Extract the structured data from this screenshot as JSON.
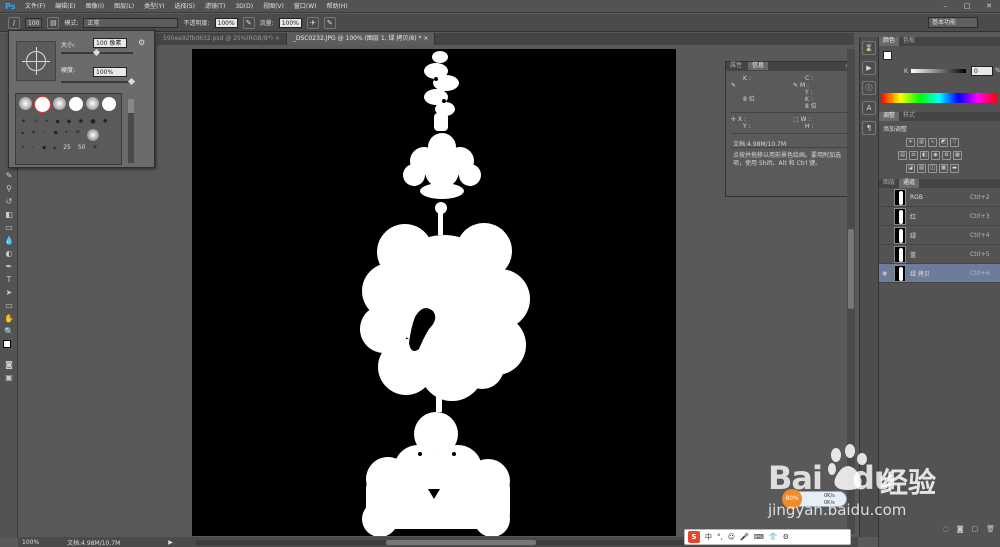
{
  "app": {
    "logo": "Ps",
    "menu": [
      "文件(F)",
      "编辑(E)",
      "图像(I)",
      "图层(L)",
      "类型(Y)",
      "选择(S)",
      "滤镜(T)",
      "3D(D)",
      "视图(V)",
      "窗口(W)",
      "帮助(H)"
    ],
    "window_controls": [
      "minimize-icon",
      "maximize-icon",
      "close-icon"
    ],
    "workspace": "基本功能"
  },
  "options_bar": {
    "brush_size": "100",
    "mode_label": "模式:",
    "mode_value": "正常",
    "opacity_label": "不透明度:",
    "opacity_value": "100%",
    "flow_label": "流量:",
    "flow_value": "100%"
  },
  "brush_popup": {
    "size_label": "大小:",
    "size_value": "100 像素",
    "hardness_label": "硬度:",
    "hardness_value": "100%",
    "preset_numbers": [
      "25",
      "50"
    ]
  },
  "tabs": [
    {
      "label": "590ee92fbd632.psd @ 25%(RGB/8*)",
      "close": "×"
    },
    {
      "label": "_DSC0232.JPG @ 100% (图层 1, 绿 拷贝/8) *",
      "close": "×"
    }
  ],
  "info_panel": {
    "tabs": [
      "属性",
      "信息"
    ],
    "k_label": "K :",
    "c_label": "C :",
    "m_label": "M :",
    "y_label": "Y :",
    "k2_label": "K :",
    "bits1": "8 位",
    "bits2": "8 位",
    "x_label": "X :",
    "y2_label": "Y :",
    "w_label": "W :",
    "h_label": "H :",
    "doc_info": "文档:4.98M/10.7M",
    "hint": "点按并拖移以用前景色绘画。要用附加选项，使用 Shift、Alt 和 Ctrl 键。"
  },
  "color_panel": {
    "tabs": [
      "颜色",
      "色板"
    ],
    "k_label": "K",
    "k_value": "0",
    "unit": "%"
  },
  "adjustments_panel": {
    "tabs": [
      "调整",
      "样式"
    ],
    "title": "添加调整"
  },
  "channels_panel": {
    "tabs": [
      "图层",
      "通道"
    ],
    "channels": [
      {
        "name": "RGB",
        "shortcut": "Ctrl+2",
        "selected": false
      },
      {
        "name": "红",
        "shortcut": "Ctrl+3",
        "selected": false
      },
      {
        "name": "绿",
        "shortcut": "Ctrl+4",
        "selected": false
      },
      {
        "name": "蓝",
        "shortcut": "Ctrl+5",
        "selected": false
      },
      {
        "name": "绿 拷贝",
        "shortcut": "Ctrl+6",
        "selected": true
      }
    ]
  },
  "status": {
    "zoom": "100%",
    "doc_info": "文档:4.98M/10.7M"
  },
  "watermark": {
    "brand": "Bai",
    "brand2": "du",
    "cn": "经验",
    "url": "jingyan.baidu.com"
  },
  "net_widget": {
    "percent": "80%",
    "up": "0K/s",
    "down": "0K/s"
  },
  "ime": {
    "logo": "S",
    "items": [
      "中",
      "°,",
      "☺",
      "🎤",
      "⌨",
      "👕",
      "⚙"
    ]
  }
}
